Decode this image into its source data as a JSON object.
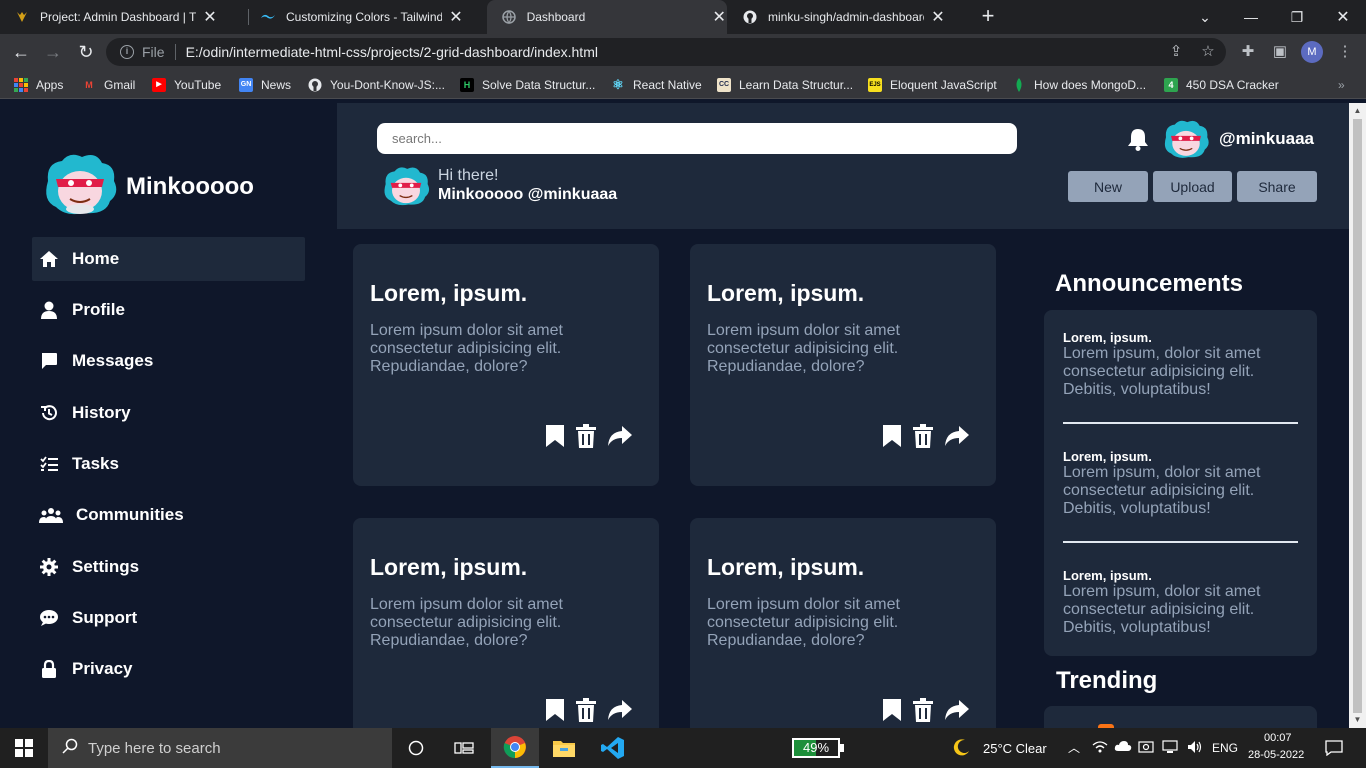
{
  "browser": {
    "tabs": [
      {
        "title": "Project: Admin Dashboard | The O",
        "icon": "odin-icon"
      },
      {
        "title": "Customizing Colors - Tailwind CS",
        "icon": "tailwind-icon"
      },
      {
        "title": "Dashboard",
        "icon": "globe-icon"
      },
      {
        "title": "minku-singh/admin-dashboard: H",
        "icon": "github-icon"
      }
    ],
    "active_tab": 2,
    "url_scheme_label": "File",
    "url": "E:/odin/intermediate-html-css/projects/2-grid-dashboard/index.html",
    "profile_initial": "M",
    "bookmarks": [
      {
        "label": "Apps",
        "icon": "apps-grid-icon"
      },
      {
        "label": "Gmail",
        "icon": "gmail-icon"
      },
      {
        "label": "YouTube",
        "icon": "youtube-icon"
      },
      {
        "label": "News",
        "icon": "news-icon"
      },
      {
        "label": "You-Dont-Know-JS:...",
        "icon": "github-icon"
      },
      {
        "label": "Solve Data Structur...",
        "icon": "hackerrank-icon"
      },
      {
        "label": "React Native",
        "icon": "react-icon"
      },
      {
        "label": "Learn Data Structur...",
        "icon": "codecademy-icon"
      },
      {
        "label": "Eloquent JavaScript",
        "icon": "js-icon"
      },
      {
        "label": "How does MongoD...",
        "icon": "mongodb-icon"
      },
      {
        "label": "450 DSA Cracker",
        "icon": "dsa-icon"
      }
    ],
    "bookmark_icon_text": {
      "gmail": "M",
      "news": "GN",
      "hackerrank": "H",
      "codecademy": "CC",
      "js": "EJS",
      "dsa": "4"
    }
  },
  "sidebar": {
    "brand": "Minkooooo",
    "items": [
      {
        "label": "Home",
        "icon": "home-icon",
        "active": true
      },
      {
        "label": "Profile",
        "icon": "user-icon"
      },
      {
        "label": "Messages",
        "icon": "message-icon"
      },
      {
        "label": "History",
        "icon": "history-icon"
      },
      {
        "label": "Tasks",
        "icon": "tasks-icon"
      },
      {
        "label": "Communities",
        "icon": "community-icon"
      },
      {
        "label": "Settings",
        "icon": "gear-icon"
      },
      {
        "label": "Support",
        "icon": "support-icon"
      },
      {
        "label": "Privacy",
        "icon": "lock-icon"
      }
    ]
  },
  "header": {
    "search_placeholder": "search...",
    "handle": "@minkuaaa",
    "greeting": "Hi there!",
    "greeting_name": "Minkooooo @minkuaaa",
    "buttons": {
      "new": "New",
      "upload": "Upload",
      "share": "Share"
    }
  },
  "cards": [
    {
      "title": "Lorem, ipsum.",
      "body": "Lorem ipsum dolor sit amet consectetur adipisicing elit. Repudiandae, dolore?"
    },
    {
      "title": "Lorem, ipsum.",
      "body": "Lorem ipsum dolor sit amet consectetur adipisicing elit. Repudiandae, dolore?"
    },
    {
      "title": "Lorem, ipsum.",
      "body": "Lorem ipsum dolor sit amet consectetur adipisicing elit. Repudiandae, dolore?"
    },
    {
      "title": "Lorem, ipsum.",
      "body": "Lorem ipsum dolor sit amet consectetur adipisicing elit. Repudiandae, dolore?"
    }
  ],
  "announcements": {
    "title": "Announcements",
    "items": [
      {
        "title": "Lorem, ipsum.",
        "body": "Lorem ipsum, dolor sit amet consectetur adipisicing elit. Debitis, voluptatibus!"
      },
      {
        "title": "Lorem, ipsum.",
        "body": "Lorem ipsum, dolor sit amet consectetur adipisicing elit. Debitis, voluptatibus!"
      },
      {
        "title": "Lorem, ipsum.",
        "body": "Lorem ipsum, dolor sit amet consectetur adipisicing elit. Debitis, voluptatibus!"
      }
    ]
  },
  "trending": {
    "title": "Trending"
  },
  "taskbar": {
    "search_placeholder": "Type here to search",
    "battery_percent": 49,
    "battery_label": "49%",
    "weather": "25°C  Clear",
    "language": "ENG",
    "time": "00:07",
    "date": "28-05-2022"
  },
  "colors": {
    "page_bg": "#0f172a",
    "panel_bg": "#1e293b",
    "muted_text": "#94a3b8",
    "button_bg": "#94a3b8"
  }
}
